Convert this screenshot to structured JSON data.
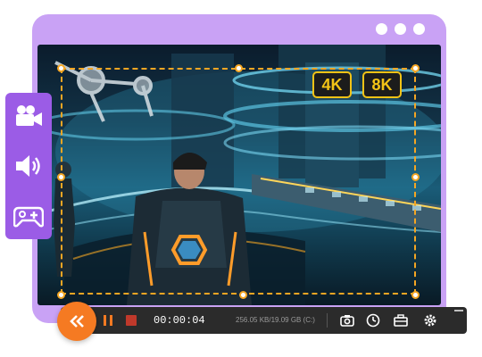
{
  "window": {
    "controls": [
      "dot",
      "dot",
      "dot"
    ]
  },
  "side_toolbar": {
    "tools": [
      {
        "name": "video-camera-icon"
      },
      {
        "name": "speaker-icon"
      },
      {
        "name": "gamepad-icon"
      }
    ]
  },
  "badges": [
    "4K",
    "8K"
  ],
  "controls": {
    "collapse_icon": "double-chevron-left-icon",
    "time": "00:00:04",
    "storage": "256.05 KB/19.09 GB (C:)",
    "tools": [
      "camera-icon",
      "clock-icon",
      "toolbox-icon",
      "gear-icon"
    ]
  },
  "colors": {
    "frame": "#c9a2f5",
    "sidebar": "#9b5ce6",
    "accent": "#f57a22",
    "dashed": "#f5a623",
    "badge_text": "#f3c316",
    "bar": "#2b2b2b"
  }
}
